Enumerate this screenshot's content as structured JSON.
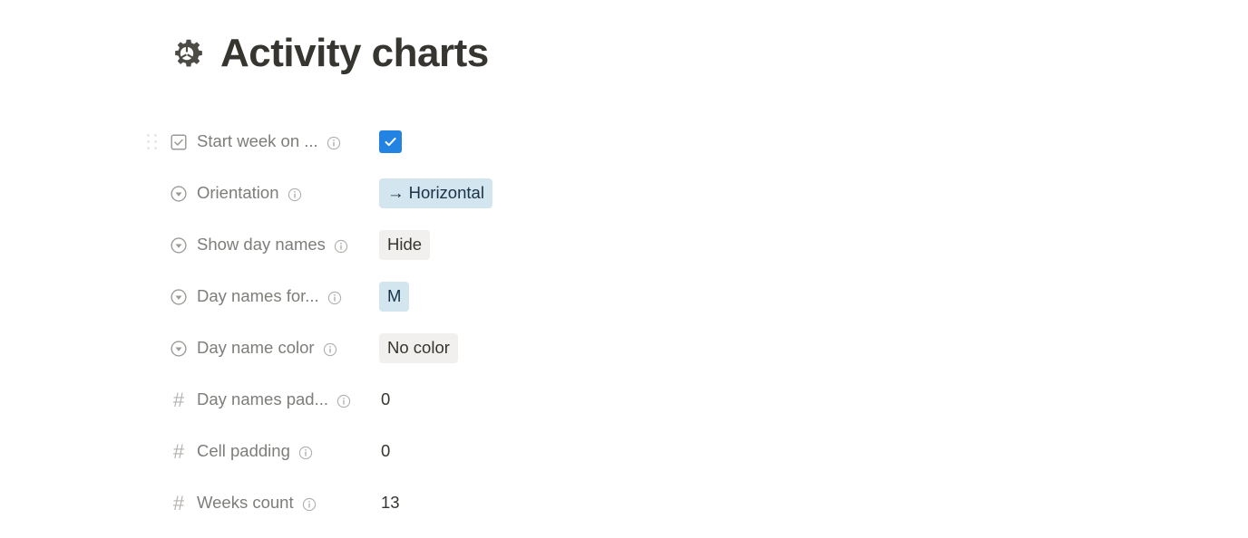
{
  "header": {
    "icon": "gear-icon",
    "title": "Activity charts"
  },
  "colors": {
    "checkbox_checked": "#2383e2",
    "pill_blue_bg": "#d3e5ef",
    "pill_blue_text": "#183347",
    "pill_gray_bg": "#f1f0ee",
    "pill_gray_text": "#37352f",
    "label_text": "#7e7d79",
    "title_text": "#37352f",
    "icon_gray": "#9b9a97",
    "page_background": "#ffffff"
  },
  "properties": [
    {
      "type_icon": "checkbox-icon",
      "label": "Start week on ...",
      "info_icon": "info-icon",
      "value_kind": "checkbox",
      "value": "checked",
      "has_drag_handle": true
    },
    {
      "type_icon": "select-icon",
      "label": "Orientation",
      "info_icon": "info-icon",
      "value_kind": "pill-blue",
      "value": "→ Horizontal",
      "has_drag_handle": false
    },
    {
      "type_icon": "select-icon",
      "label": "Show day names",
      "info_icon": "info-icon",
      "value_kind": "pill-gray",
      "value": "Hide",
      "has_drag_handle": false
    },
    {
      "type_icon": "select-icon",
      "label": "Day names for...",
      "info_icon": "info-icon",
      "value_kind": "pill-blue",
      "value": "M",
      "has_drag_handle": false
    },
    {
      "type_icon": "select-icon",
      "label": "Day name color",
      "info_icon": "info-icon",
      "value_kind": "pill-gray",
      "value": "No color",
      "has_drag_handle": false
    },
    {
      "type_icon": "number-icon",
      "label": "Day names pad...",
      "info_icon": "info-icon",
      "value_kind": "number",
      "value": "0",
      "has_drag_handle": false
    },
    {
      "type_icon": "number-icon",
      "label": "Cell padding",
      "info_icon": "info-icon",
      "value_kind": "number",
      "value": "0",
      "has_drag_handle": false
    },
    {
      "type_icon": "number-icon",
      "label": "Weeks count",
      "info_icon": "info-icon",
      "value_kind": "number",
      "value": "13",
      "has_drag_handle": false
    }
  ]
}
